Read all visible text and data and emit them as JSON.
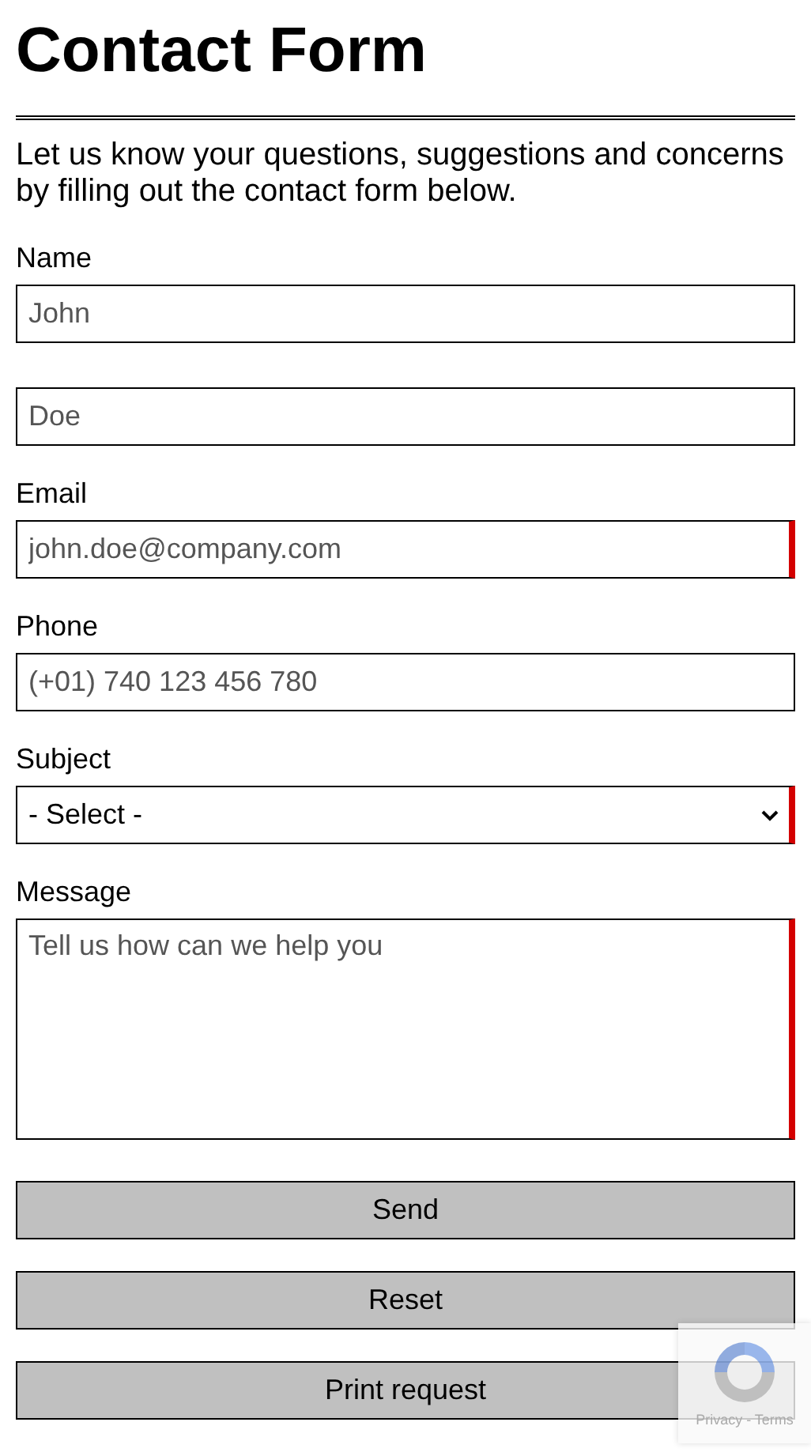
{
  "title": "Contact Form",
  "intro": "Let us know your questions, suggestions and concerns by filling out the contact form below.",
  "fields": [
    {
      "kind": "input",
      "label": "Name",
      "placeholder": "John",
      "required": false
    },
    {
      "kind": "input",
      "placeholder": "Doe",
      "required": false
    },
    {
      "kind": "input",
      "label": "Email",
      "placeholder": "john.doe@company.com",
      "required": true
    },
    {
      "kind": "input",
      "label": "Phone",
      "placeholder": "(+01) 740 123 456 780",
      "required": false
    },
    {
      "kind": "select",
      "label": "Subject",
      "value": "- Select -",
      "required": true
    },
    {
      "kind": "textarea",
      "label": "Message",
      "placeholder": "Tell us how can we help you",
      "required": true
    }
  ],
  "buttons": [
    "Send",
    "Reset",
    "Print request"
  ],
  "captcha": {
    "links": "Privacy - Terms"
  }
}
